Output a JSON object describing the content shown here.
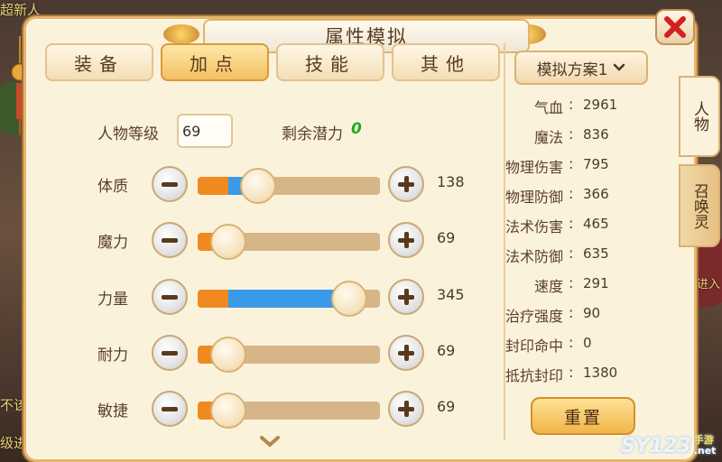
{
  "window": {
    "title": "属性模拟"
  },
  "tabs": [
    {
      "label": "装备",
      "active": false
    },
    {
      "label": "加点",
      "active": true
    },
    {
      "label": "技能",
      "active": false
    },
    {
      "label": "其他",
      "active": false
    }
  ],
  "level": {
    "label": "人物等级",
    "value": "69"
  },
  "remaining": {
    "label": "剩余潜力",
    "value": "0"
  },
  "attributes": [
    {
      "name": "体质",
      "value": "138",
      "base_fraction": 0.17,
      "added_fraction": 0.08,
      "knob_fraction": 0.33
    },
    {
      "name": "魔力",
      "value": "69",
      "base_fraction": 0.17,
      "added_fraction": 0.0,
      "knob_fraction": 0.17
    },
    {
      "name": "力量",
      "value": "345",
      "base_fraction": 0.17,
      "added_fraction": 0.66,
      "knob_fraction": 0.83
    },
    {
      "name": "耐力",
      "value": "69",
      "base_fraction": 0.17,
      "added_fraction": 0.0,
      "knob_fraction": 0.17
    },
    {
      "name": "敏捷",
      "value": "69",
      "base_fraction": 0.17,
      "added_fraction": 0.0,
      "knob_fraction": 0.17
    }
  ],
  "plan": {
    "selected": "模拟方案1"
  },
  "stats": [
    {
      "label": "气血",
      "value": "2961"
    },
    {
      "label": "魔法",
      "value": "836"
    },
    {
      "label": "物理伤害",
      "value": "795"
    },
    {
      "label": "物理防御",
      "value": "366"
    },
    {
      "label": "法术伤害",
      "value": "465"
    },
    {
      "label": "法术防御",
      "value": "635"
    },
    {
      "label": "速度",
      "value": "291"
    },
    {
      "label": "治疗强度",
      "value": "90"
    },
    {
      "label": "封印命中",
      "value": "0"
    },
    {
      "label": "抵抗封印",
      "value": "1380"
    }
  ],
  "stat_separator": ":",
  "reset_label": "重置",
  "side_tabs": [
    {
      "label": "人物",
      "active": true
    },
    {
      "label": "召唤灵",
      "active": false
    }
  ],
  "background_text": {
    "left_top": "超新人",
    "left_mid": "不该",
    "left_bottom": "级进",
    "right_mid": "进入"
  },
  "watermark": {
    "main": "SY123",
    "sub": "手游",
    "tld": ".net"
  },
  "colors": {
    "base_fill": "#f08a20",
    "added_fill": "#3a9ae8",
    "remaining_value": "#1ab01a",
    "close_x": "#d42020"
  }
}
